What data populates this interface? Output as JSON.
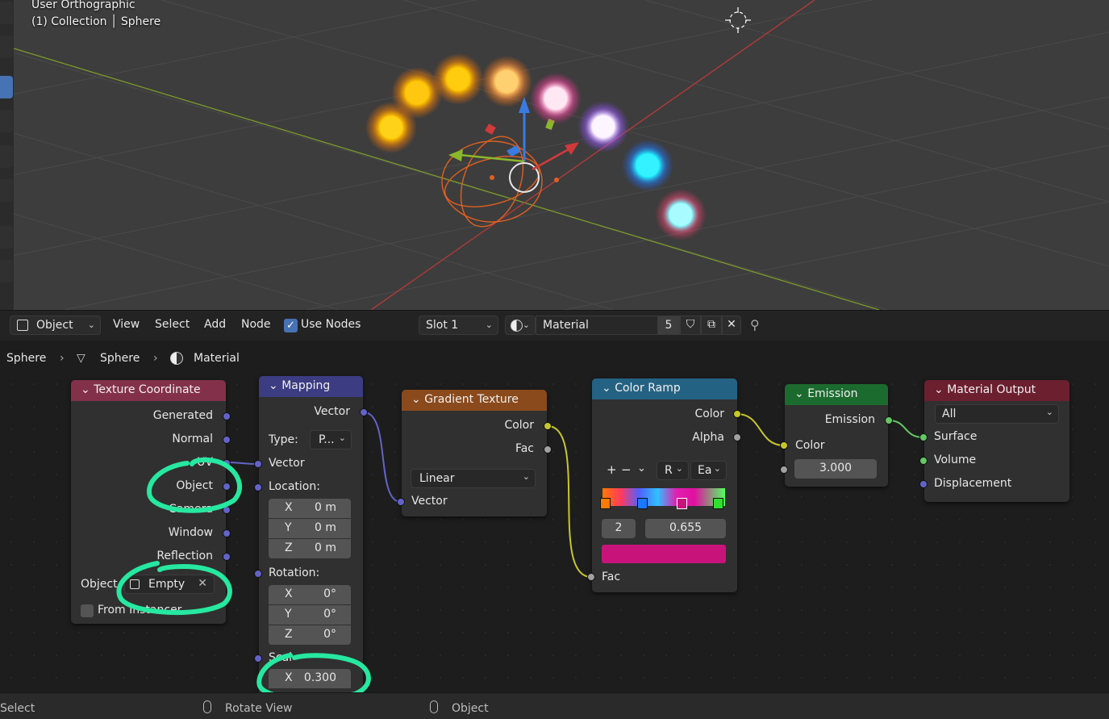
{
  "viewport": {
    "view_name": "User Orthographic",
    "collection": "(1) Collection",
    "object": "Sphere"
  },
  "header": {
    "editor_type": "Object",
    "menu": [
      "View",
      "Select",
      "Add",
      "Node"
    ],
    "use_nodes_label": "Use Nodes",
    "use_nodes_checked": true,
    "slot": "Slot 1",
    "material": "Material",
    "user_count": "5"
  },
  "breadcrumb": [
    "Sphere",
    "Sphere",
    "Material"
  ],
  "nodes": {
    "texture_coordinate": {
      "title": "Texture Coordinate",
      "color": "#83314a",
      "outputs": [
        "Generated",
        "Normal",
        "UV",
        "Object",
        "Camera",
        "Window",
        "Reflection"
      ],
      "object_label": "Object",
      "object_value": "Empty",
      "from_instancer": "From Instancer"
    },
    "mapping": {
      "title": "Mapping",
      "color": "#3c3c83",
      "output": "Vector",
      "type_label": "Type:",
      "type_value": "P...",
      "vector_label": "Vector",
      "location_label": "Location:",
      "location": [
        {
          "axis": "X",
          "value": "0 m"
        },
        {
          "axis": "Y",
          "value": "0 m"
        },
        {
          "axis": "Z",
          "value": "0 m"
        }
      ],
      "rotation_label": "Rotation:",
      "rotation": [
        {
          "axis": "X",
          "value": "0°"
        },
        {
          "axis": "Y",
          "value": "0°"
        },
        {
          "axis": "Z",
          "value": "0°"
        }
      ],
      "scale_label": "Scale:",
      "scale_x": {
        "axis": "X",
        "value": "0.300"
      }
    },
    "gradient_texture": {
      "title": "Gradient Texture",
      "color": "#8a4a1c",
      "outputs": [
        "Color",
        "Fac"
      ],
      "type_value": "Linear",
      "input": "Vector"
    },
    "color_ramp": {
      "title": "Color Ramp",
      "color": "#246283",
      "outputs": [
        "Color",
        "Alpha"
      ],
      "mode": "R",
      "interp": "Ea",
      "stop_index": "2",
      "stop_pos": "0.655",
      "stop_color": "#c8147a",
      "input": "Fac"
    },
    "emission": {
      "title": "Emission",
      "color": "#1b6b2e",
      "output": "Emission",
      "input_color": "Color",
      "strength": "3.000"
    },
    "material_output": {
      "title": "Material Output",
      "color": "#6b1f2f",
      "target": "All",
      "inputs": [
        "Surface",
        "Volume",
        "Displacement"
      ]
    }
  },
  "statusbar": {
    "left": "Select",
    "middle": "Rotate View",
    "right": "Object"
  },
  "colors": {
    "annotation": "#26e8a0",
    "accent": "#4772b3"
  }
}
